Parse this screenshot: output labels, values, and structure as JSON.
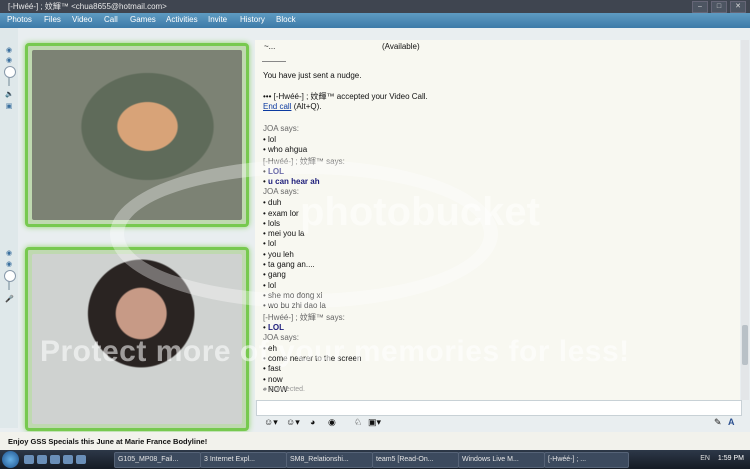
{
  "window": {
    "title": "[-Hwéé-] ; 妏輝™ <chua8655@hotmail.com>"
  },
  "menu": [
    "Photos",
    "Files",
    "Video",
    "Call",
    "Games",
    "Activities",
    "Invite",
    "History",
    "Block"
  ],
  "contact": {
    "name": "~...",
    "status": "(Available)"
  },
  "chat": {
    "nudge": "You have just sent a nudge.",
    "accept_prefix": "•••",
    "accept_text": "[-Hwéé-] ; 妏輝™ accepted your Video Call.",
    "end_call_link": "End call",
    "end_call_shortcut": "(Alt+Q).",
    "messages": [
      {
        "type": "says",
        "text": "JOA says:"
      },
      {
        "type": "item",
        "text": "lol"
      },
      {
        "type": "item",
        "text": "who ahgua"
      },
      {
        "type": "says",
        "text": "[-Hwéé-] ; 妏輝™ says:"
      },
      {
        "type": "item-blue",
        "text": "LOL"
      },
      {
        "type": "item-blue",
        "text": "u can hear ah"
      },
      {
        "type": "says",
        "text": "JOA says:"
      },
      {
        "type": "item",
        "text": "duh"
      },
      {
        "type": "item",
        "text": "exam lor"
      },
      {
        "type": "item",
        "text": "lols"
      },
      {
        "type": "item",
        "text": "mei you la"
      },
      {
        "type": "item",
        "text": "lol"
      },
      {
        "type": "item",
        "text": "you leh"
      },
      {
        "type": "item",
        "text": "ta gang an...."
      },
      {
        "type": "item",
        "text": "gang"
      },
      {
        "type": "item",
        "text": "lol"
      },
      {
        "type": "item",
        "text": "she mo dong xi"
      },
      {
        "type": "item",
        "text": "wo bu zhi dao la"
      },
      {
        "type": "says",
        "text": "[-Hwéé-] ; 妏輝™ says:"
      },
      {
        "type": "item-blue",
        "text": "LOL"
      },
      {
        "type": "says",
        "text": "JOA says:"
      },
      {
        "type": "item",
        "text": "eh"
      },
      {
        "type": "item",
        "text": "come nearer to the screen"
      },
      {
        "type": "item",
        "text": "fast"
      },
      {
        "type": "item",
        "text": "now"
      },
      {
        "type": "item",
        "text": "NOW"
      }
    ],
    "connected": "Connected."
  },
  "ad": "Enjoy GSS Specials this June at Marie France Bodyline!",
  "taskbar": {
    "tasks": [
      "G105_MP08_Fail...",
      "3 Internet Expl...",
      "SM8_Relationshi...",
      "team5 [Read-On...",
      "Windows Live M...",
      "[-Hwéé-] ; ..."
    ],
    "lang": "EN",
    "time": "1:59 PM"
  },
  "watermark": {
    "brand": "photobucket",
    "slogan": "Protect more of your memories for less!"
  }
}
